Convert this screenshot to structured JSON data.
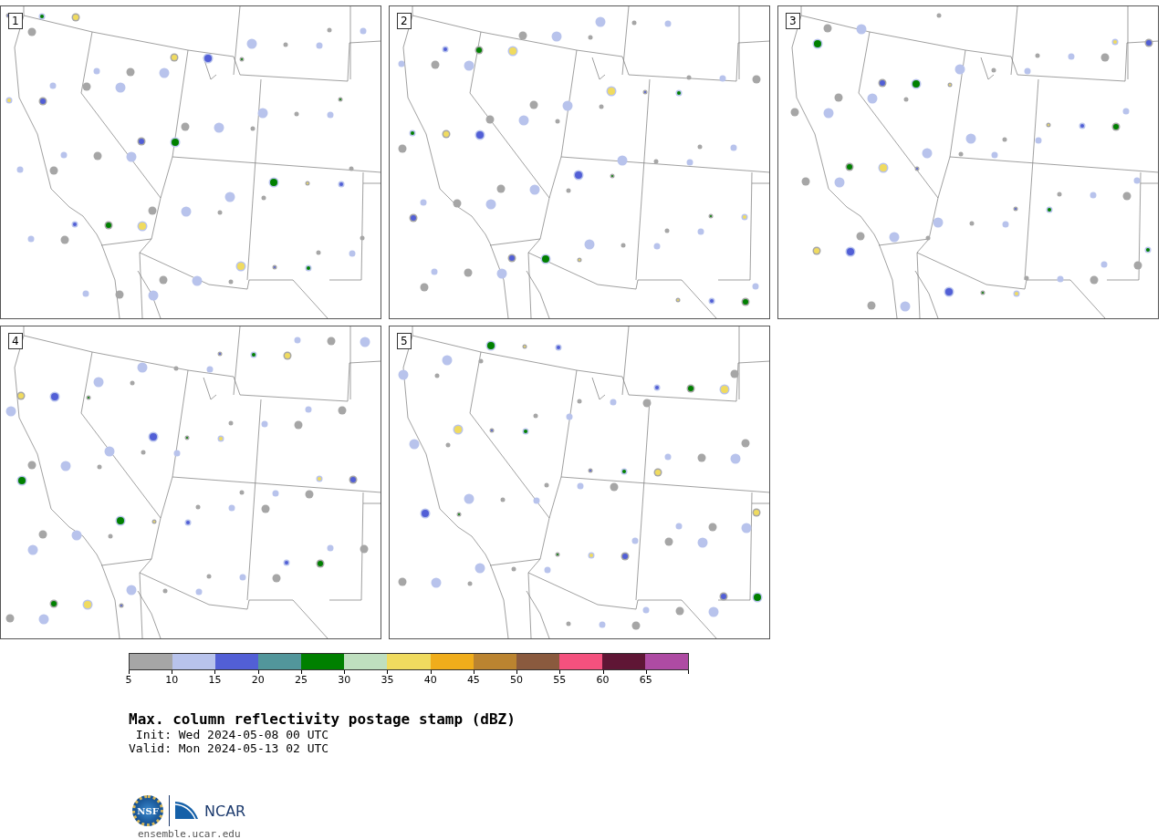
{
  "panels": [
    {
      "number": "1"
    },
    {
      "number": "2"
    },
    {
      "number": "3"
    },
    {
      "number": "4"
    },
    {
      "number": "5"
    }
  ],
  "colorbar": {
    "segments": [
      {
        "label": "5",
        "color": "#a6a6a6"
      },
      {
        "label": "10",
        "color": "#b8c3ec"
      },
      {
        "label": "15",
        "color": "#525fd6"
      },
      {
        "label": "20",
        "color": "#52969b"
      },
      {
        "label": "25",
        "color": "#008000"
      },
      {
        "label": "30",
        "color": "#bfdfbf"
      },
      {
        "label": "35",
        "color": "#f0db5f"
      },
      {
        "label": "40",
        "color": "#f0ad1b"
      },
      {
        "label": "45",
        "color": "#bb8430"
      },
      {
        "label": "50",
        "color": "#8a5a3e"
      },
      {
        "label": "55",
        "color": "#f4517e"
      },
      {
        "label": "60",
        "color": "#5f1635"
      },
      {
        "label": "65",
        "color": "#ae4ba3"
      }
    ]
  },
  "title": "Max. column reflectivity postage stamp (dBZ)",
  "init": " Init: Wed 2024-05-08 00 UTC",
  "valid": "Valid: Mon 2024-05-13 02 UTC",
  "logo": {
    "nsf": "NSF",
    "ncar": "NCAR"
  },
  "footer": "ensemble.ucar.edu"
}
